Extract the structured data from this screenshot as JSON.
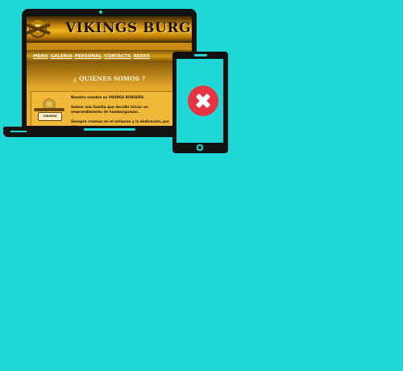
{
  "site": {
    "title": "VIKINGS BURGERS",
    "nav": [
      "MENU",
      "GALERIA",
      "PERSONAL",
      "CONTACTS",
      "REDES"
    ],
    "section_title": "¿ QUIÉNES SOMOS ?",
    "logo_ribbon": "VIKINGS",
    "paragraphs": [
      "Nuestro nombre es VIKINGS BURGERS.",
      "Somos una familia que decidió iniciar un emprendimiento de hamburguesas.",
      "Siempre creimos en el esfuerzo y la dedicación, por eso"
    ]
  },
  "phone": {
    "status_icon": "error-x-icon",
    "status_color": "#e73342"
  },
  "colors": {
    "background": "#1fd8d6",
    "device": "#121212",
    "brand_gold": "#e4a82a"
  }
}
